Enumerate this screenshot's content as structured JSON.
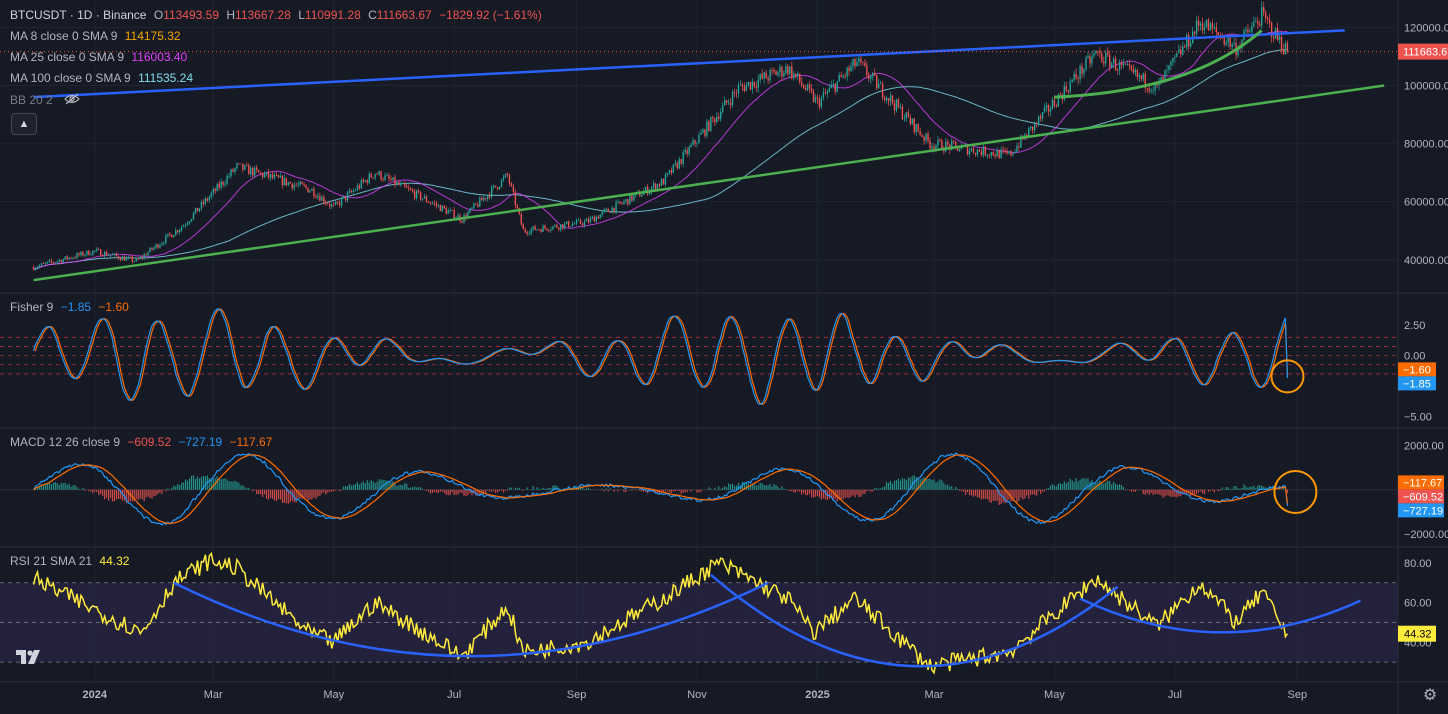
{
  "header": {
    "symbol": "BTCUSDT · 1D · Binance",
    "o_label": "O",
    "o": "113493.59",
    "h_label": "H",
    "h": "113667.28",
    "l_label": "L",
    "l": "110991.28",
    "c_label": "C",
    "c": "111663.67",
    "change": "−1829.92 (−1.61%)"
  },
  "indicators": {
    "ma8": {
      "label": "MA 8 close 0 SMA 9",
      "value": "114175.32",
      "color": "#f7a600"
    },
    "ma25": {
      "label": "MA 25 close 0 SMA 9",
      "value": "116003.40",
      "color": "#e040fb"
    },
    "ma100": {
      "label": "MA 100 close 0 SMA 9",
      "value": "111535.24",
      "color": "#80deea"
    },
    "bb": {
      "label": "BB 20 2"
    },
    "fisher": {
      "label": "Fisher 9",
      "v1": "−1.85",
      "v2": "−1.60"
    },
    "macd": {
      "label": "MACD 12 26 close 9",
      "v1": "−609.52",
      "v2": "−727.19",
      "v3": "−117.67"
    },
    "rsi": {
      "label": "RSI 21 SMA 21",
      "value": "44.32"
    }
  },
  "colors": {
    "background": "#161a25",
    "up": "#26a69a",
    "down": "#ef5350",
    "trend_blue": "#2962ff",
    "trend_green": "#4caf50",
    "fisher_blue": "#2196f3",
    "fisher_orange": "#ff6d00",
    "rsi_yellow": "#ffeb3b",
    "circle": "#ff9800"
  },
  "icons": {
    "logo": "tradingview-logo-icon",
    "collapse": "chevron-up-icon",
    "settings": "gear-icon",
    "hide": "eye-off-icon"
  },
  "chart_data": [
    {
      "type": "candlestick",
      "pane": "price",
      "y_ticks": [
        "120000.00",
        "100000.00",
        "80000.00",
        "60000.00",
        "40000.00"
      ],
      "y_range": [
        32000,
        126000
      ],
      "last_price_label": "111663.67",
      "x_ticks": [
        "2024",
        "Mar",
        "May",
        "Jul",
        "Sep",
        "Nov",
        "2025",
        "Mar",
        "May",
        "Jul",
        "Sep"
      ],
      "price_path": [
        {
          "date": "2023-12-01",
          "price": 37500
        },
        {
          "date": "2024-01-01",
          "price": 43000
        },
        {
          "date": "2024-01-22",
          "price": 39500
        },
        {
          "date": "2024-02-15",
          "price": 52000
        },
        {
          "date": "2024-03-13",
          "price": 72000
        },
        {
          "date": "2024-04-20",
          "price": 64000
        },
        {
          "date": "2024-05-01",
          "price": 58000
        },
        {
          "date": "2024-05-22",
          "price": 70000
        },
        {
          "date": "2024-07-05",
          "price": 54000
        },
        {
          "date": "2024-07-28",
          "price": 69000
        },
        {
          "date": "2024-08-05",
          "price": 50000
        },
        {
          "date": "2024-09-06",
          "price": 53000
        },
        {
          "date": "2024-10-15",
          "price": 67000
        },
        {
          "date": "2024-11-22",
          "price": 99000
        },
        {
          "date": "2024-12-17",
          "price": 106000
        },
        {
          "date": "2025-01-01",
          "price": 94000
        },
        {
          "date": "2025-01-21",
          "price": 108000
        },
        {
          "date": "2025-02-27",
          "price": 80000
        },
        {
          "date": "2025-04-08",
          "price": 76000
        },
        {
          "date": "2025-05-22",
          "price": 111000
        },
        {
          "date": "2025-06-22",
          "price": 99000
        },
        {
          "date": "2025-07-14",
          "price": 122000
        },
        {
          "date": "2025-08-01",
          "price": 113000
        },
        {
          "date": "2025-08-14",
          "price": 124000
        },
        {
          "date": "2025-08-27",
          "price": 111663
        }
      ],
      "trendlines": [
        {
          "name": "",
          "color": "#2962ff",
          "points": [
            {
              "date": "2023-12-01",
              "price": 96000
            },
            {
              "date": "2025-09-25",
              "price": 119000
            }
          ]
        },
        {
          "name": "",
          "color": "#4caf50",
          "points": [
            {
              "date": "2023-12-01",
              "price": 33000
            },
            {
              "date": "2025-10-15",
              "price": 100000
            }
          ]
        }
      ]
    },
    {
      "type": "line",
      "pane": "fisher",
      "y_ticks": [
        "2.50",
        "0.00",
        "−2.50",
        "−5.00"
      ],
      "y_range": [
        -5.6,
        4.8
      ],
      "hlines": [
        1.5,
        0.75,
        0,
        -0.75,
        -1.5
      ],
      "series": [
        {
          "name": "",
          "last": -1.85
        },
        {
          "name": "",
          "last": -1.6
        }
      ],
      "highlight": {
        "date": "2025-08-27",
        "value": -1.7
      }
    },
    {
      "type": "line+histogram",
      "pane": "macd",
      "y_ticks": [
        "2000.00",
        "−2000.00"
      ],
      "y_range": [
        -2400,
        2600
      ],
      "series": [
        {
          "name": "",
          "last": -727.19
        },
        {
          "name": "",
          "last": -609.52
        },
        {
          "name": "",
          "last": -117.67
        }
      ],
      "highlight": {
        "date": "2025-08-27",
        "value": -100
      }
    },
    {
      "type": "line",
      "pane": "rsi",
      "y_ticks": [
        "80.00",
        "60.00",
        "40.00"
      ],
      "y_range": [
        22,
        86
      ],
      "band": [
        30,
        70
      ],
      "rsi_path": [
        {
          "date": "2023-12-01",
          "rsi": 72
        },
        {
          "date": "2024-01-10",
          "rsi": 52
        },
        {
          "date": "2024-01-25",
          "rsi": 45
        },
        {
          "date": "2024-02-10",
          "rsi": 70
        },
        {
          "date": "2024-02-28",
          "rsi": 81
        },
        {
          "date": "2024-03-12",
          "rsi": 78
        },
        {
          "date": "2024-04-18",
          "rsi": 45
        },
        {
          "date": "2024-05-01",
          "rsi": 40
        },
        {
          "date": "2024-05-22",
          "rsi": 60
        },
        {
          "date": "2024-07-05",
          "rsi": 33
        },
        {
          "date": "2024-07-28",
          "rsi": 58
        },
        {
          "date": "2024-08-05",
          "rsi": 35
        },
        {
          "date": "2024-09-06",
          "rsi": 40
        },
        {
          "date": "2024-10-15",
          "rsi": 62
        },
        {
          "date": "2024-11-12",
          "rsi": 80
        },
        {
          "date": "2024-12-17",
          "rsi": 62
        },
        {
          "date": "2024-12-30",
          "rsi": 45
        },
        {
          "date": "2025-01-20",
          "rsi": 62
        },
        {
          "date": "2025-02-27",
          "rsi": 28
        },
        {
          "date": "2025-04-08",
          "rsi": 35
        },
        {
          "date": "2025-05-22",
          "rsi": 72
        },
        {
          "date": "2025-06-22",
          "rsi": 48
        },
        {
          "date": "2025-07-14",
          "rsi": 70
        },
        {
          "date": "2025-08-01",
          "rsi": 50
        },
        {
          "date": "2025-08-14",
          "rsi": 65
        },
        {
          "date": "2025-08-27",
          "rsi": 44.32
        }
      ],
      "arcs": [
        {
          "from": {
            "date": "2024-02-10",
            "rsi": 70
          },
          "to": {
            "date": "2024-12-07",
            "rsi": 70
          },
          "min_rsi": 33
        },
        {
          "from": {
            "date": "2024-11-08",
            "rsi": 74
          },
          "to": {
            "date": "2025-06-02",
            "rsi": 68
          },
          "min_rsi": 28
        },
        {
          "from": {
            "date": "2025-05-14",
            "rsi": 62
          },
          "to": {
            "date": "2025-10-03",
            "rsi": 61
          },
          "min_rsi": 45
        }
      ]
    }
  ]
}
